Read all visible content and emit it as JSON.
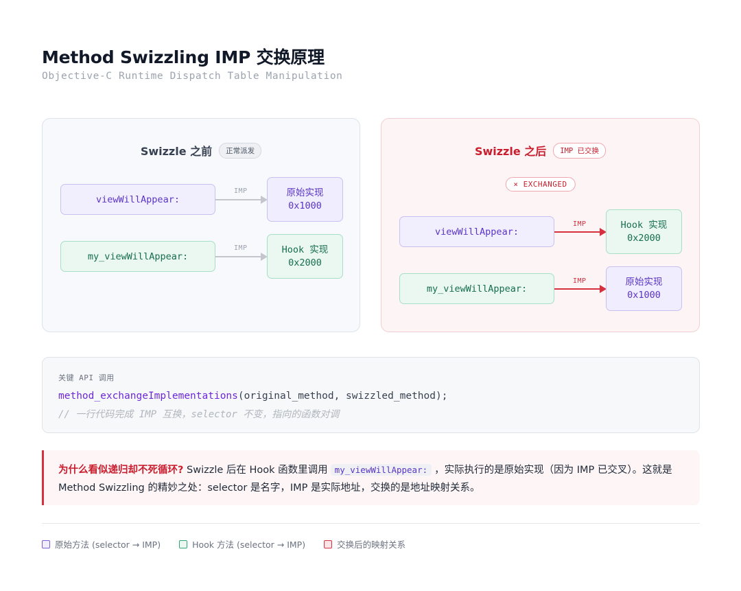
{
  "header": {
    "title": "Method Swizzling IMP 交换原理",
    "subtitle": "Objective-C Runtime Dispatch Table Manipulation"
  },
  "before": {
    "title": "Swizzle 之前",
    "badge": "正常派发",
    "rows": [
      {
        "selector": "viewWillAppear:",
        "arrow_label": "IMP",
        "imp_name": "原始实现",
        "imp_addr": "0x1000"
      },
      {
        "selector": "my_viewWillAppear:",
        "arrow_label": "IMP",
        "imp_name": "Hook 实现",
        "imp_addr": "0x2000"
      }
    ]
  },
  "after": {
    "title": "Swizzle 之后",
    "badge": "IMP 已交换",
    "exchanged_badge": "× EXCHANGED",
    "rows": [
      {
        "selector": "viewWillAppear:",
        "arrow_label": "IMP",
        "imp_name": "Hook 实现",
        "imp_addr": "0x2000"
      },
      {
        "selector": "my_viewWillAppear:",
        "arrow_label": "IMP",
        "imp_name": "原始实现",
        "imp_addr": "0x1000"
      }
    ]
  },
  "code": {
    "label": "关键 API 调用",
    "function": "method_exchangeImplementations",
    "args": "(original_method, swizzled_method);",
    "comment": "// 一行代码完成 IMP 互换，selector 不变，指向的函数对调"
  },
  "note": {
    "strong": "为什么看似递归却不死循环?",
    "part1": " Swizzle 后在 Hook 函数里调用",
    "code": "my_viewWillAppear:",
    "part2": "，实际执行的是原始实现（因为 IMP 已交叉）。这就是 Method Swizzling 的精妙之处：selector 是名字，IMP 是实际地址，交换的是地址映射关系。"
  },
  "legend": [
    {
      "label": "原始方法 (selector → IMP)",
      "color": "purple"
    },
    {
      "label": "Hook 方法 (selector → IMP)",
      "color": "green"
    },
    {
      "label": "交换后的映射关系",
      "color": "red"
    }
  ]
}
